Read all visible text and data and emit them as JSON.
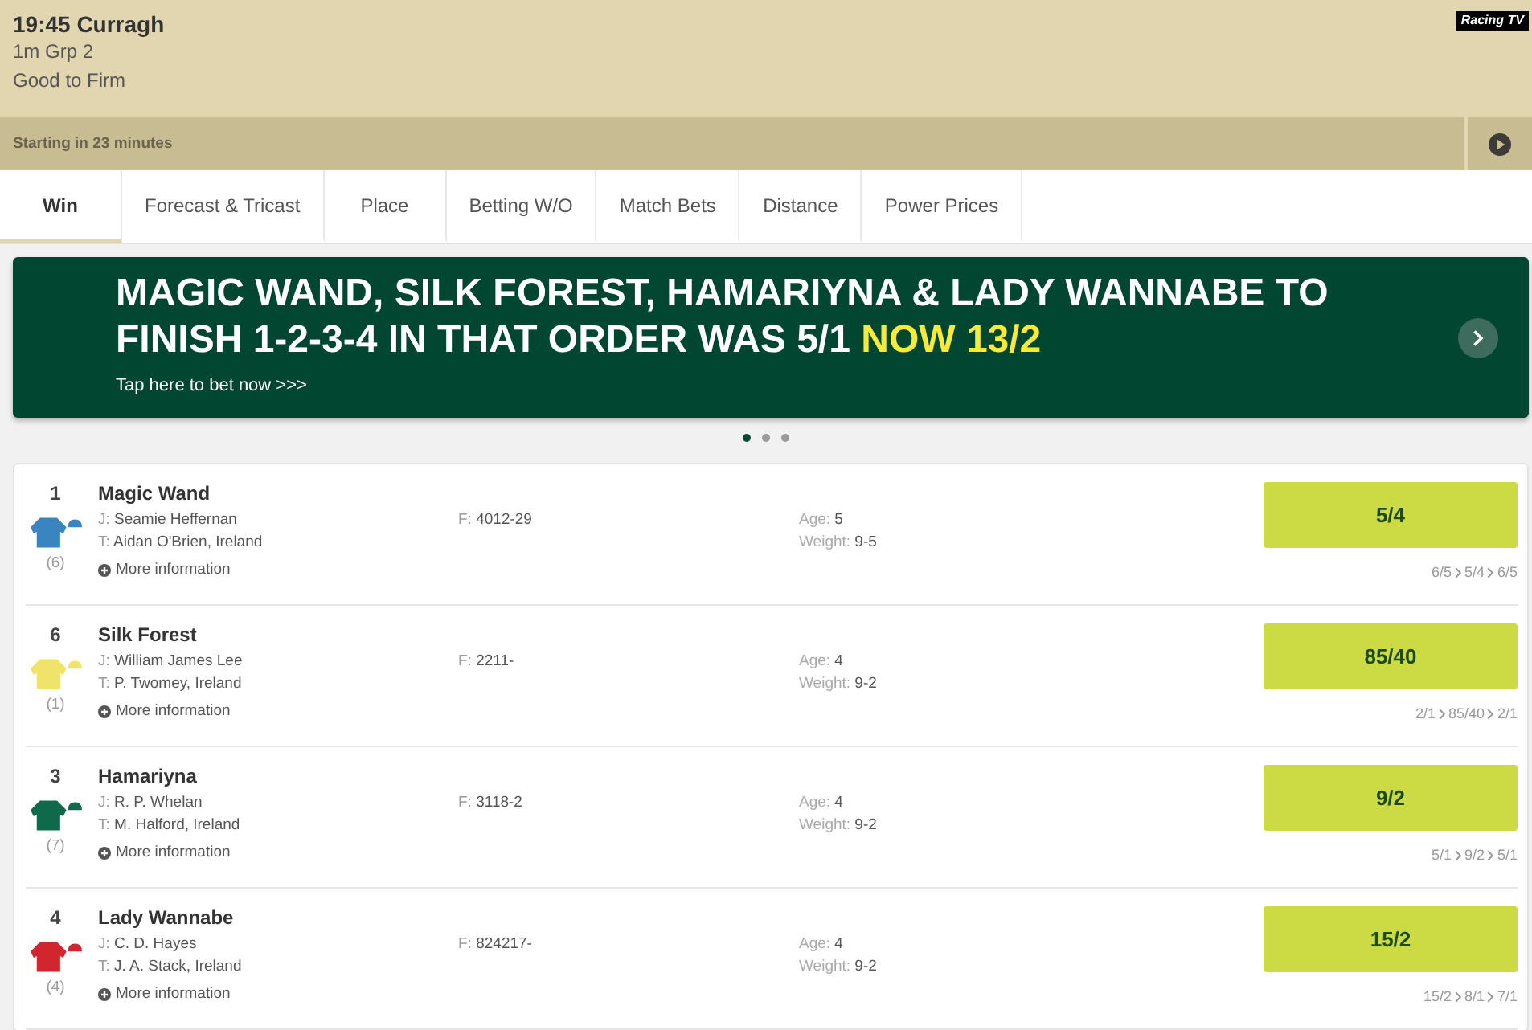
{
  "race": {
    "title": "19:45 Curragh",
    "details": [
      "1m Grp 2",
      "Good to Firm"
    ],
    "logo": "Racing TV"
  },
  "status_bar": {
    "text": "Starting in 23 minutes"
  },
  "tabs": [
    {
      "label": "Win",
      "selected": true
    },
    {
      "label": "Forecast & Tricast",
      "selected": false
    },
    {
      "label": "Place",
      "selected": false
    },
    {
      "label": "Betting W/O",
      "selected": false
    },
    {
      "label": "Match Bets",
      "selected": false
    },
    {
      "label": "Distance",
      "selected": false
    },
    {
      "label": "Power Prices",
      "selected": false
    }
  ],
  "banner": {
    "headline": "MAGIC WAND, SILK FOREST, HAMARIYNA & LADY WANNABE TO FINISH 1-2-3-4 IN THAT ORDER WAS 5/1",
    "headline_highlight": "NOW 13/2",
    "link": "Tap here to bet now >>>",
    "dots": [
      {
        "selected": true
      },
      {
        "selected": false
      },
      {
        "selected": false
      }
    ]
  },
  "runners": [
    {
      "number": "1",
      "draw": "(6)",
      "color": "#3a84bf",
      "name": "Magic Wand",
      "jockey": {
        "label": "J:",
        "value": "Seamie Heffernan"
      },
      "trainer": {
        "label": "T:",
        "value": "Aidan O'Brien, Ireland"
      },
      "more_info": "More information",
      "form": {
        "label": "F:",
        "value": "4012-29"
      },
      "age": {
        "label": "Age:",
        "value": "5"
      },
      "weight": {
        "label": "Weight:",
        "value": "9-5"
      },
      "odds": "5/4",
      "price_history": [
        "6/5",
        "5/4",
        "6/5"
      ]
    },
    {
      "number": "6",
      "draw": "(1)",
      "color": "#f0e36a",
      "name": "Silk Forest",
      "jockey": {
        "label": "J:",
        "value": "William James Lee"
      },
      "trainer": {
        "label": "T:",
        "value": "P. Twomey, Ireland"
      },
      "more_info": "More information",
      "form": {
        "label": "F:",
        "value": "2211-"
      },
      "age": {
        "label": "Age:",
        "value": "4"
      },
      "weight": {
        "label": "Weight:",
        "value": "9-2"
      },
      "odds": "85/40",
      "price_history": [
        "2/1",
        "85/40",
        "2/1"
      ]
    },
    {
      "number": "3",
      "draw": "(7)",
      "color": "#0f6a4b",
      "name": "Hamariyna",
      "jockey": {
        "label": "J:",
        "value": "R. P. Whelan"
      },
      "trainer": {
        "label": "T:",
        "value": "M. Halford, Ireland"
      },
      "more_info": "More information",
      "form": {
        "label": "F:",
        "value": "3118-2"
      },
      "age": {
        "label": "Age:",
        "value": "4"
      },
      "weight": {
        "label": "Weight:",
        "value": "9-2"
      },
      "odds": "9/2",
      "price_history": [
        "5/1",
        "9/2",
        "5/1"
      ]
    },
    {
      "number": "4",
      "draw": "(4)",
      "color": "#d2262f",
      "name": "Lady Wannabe",
      "jockey": {
        "label": "J:",
        "value": "C. D. Hayes"
      },
      "trainer": {
        "label": "T:",
        "value": "J. A. Stack, Ireland"
      },
      "more_info": "More information",
      "form": {
        "label": "F:",
        "value": "824217-"
      },
      "age": {
        "label": "Age:",
        "value": "4"
      },
      "weight": {
        "label": "Weight:",
        "value": "9-2"
      },
      "odds": "15/2",
      "price_history": [
        "15/2",
        "8/1",
        "7/1"
      ]
    }
  ]
}
